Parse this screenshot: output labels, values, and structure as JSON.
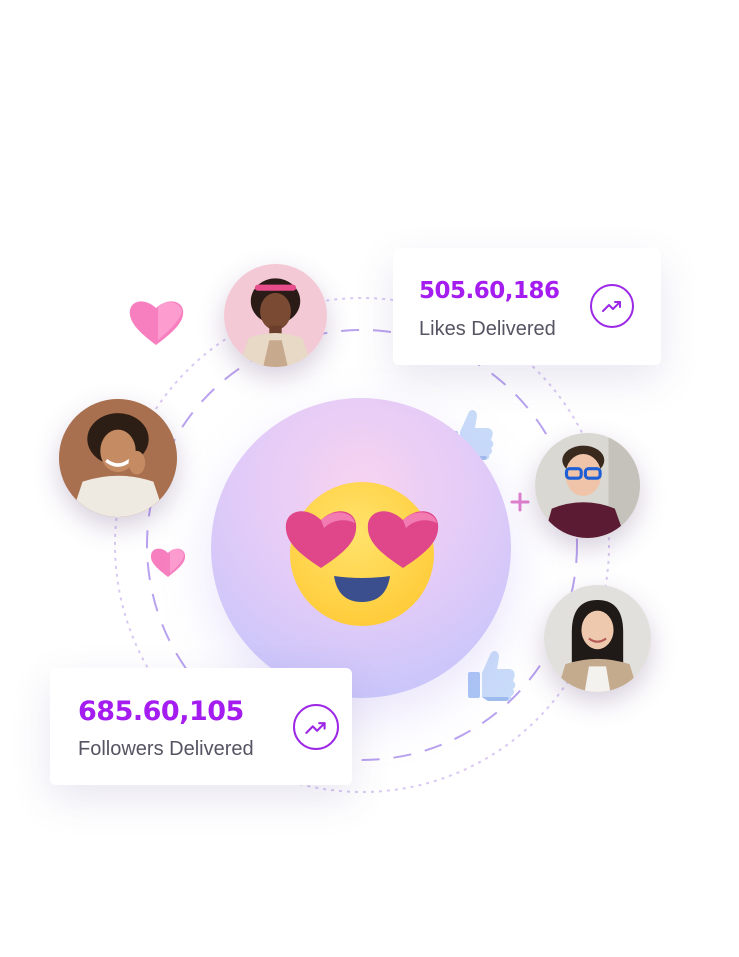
{
  "likes_card": {
    "value": "505.60,186",
    "label": "Likes Delivered",
    "trend_icon": "trending-up-icon"
  },
  "followers_card": {
    "value": "685.60,105",
    "label": "Followers Delivered",
    "trend_icon": "trending-up-icon"
  },
  "center_emoji": "heart-eyes-emoji",
  "decorations": [
    "heart-icon",
    "thumbs-up-icon",
    "plus-icon"
  ],
  "colors": {
    "accent_purple": "#a51cf0",
    "label_gray": "#555462",
    "heart_pink": "#f77fbf",
    "thumb_blue": "#b3cdf7"
  }
}
